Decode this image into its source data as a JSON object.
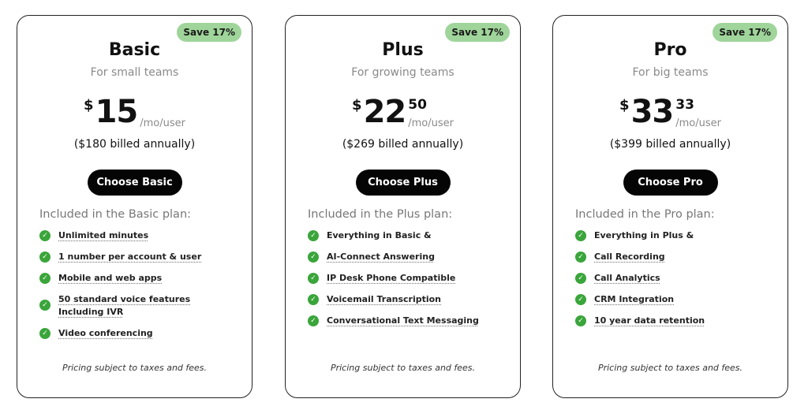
{
  "plans": [
    {
      "badge": "Save 17%",
      "name": "Basic",
      "subtitle": "For small teams",
      "currency": "$",
      "amount": "15",
      "cents": "",
      "per": "/mo/user",
      "billed": "($180 billed annually)",
      "cta": "Choose Basic",
      "included_title": "Included in the Basic plan:",
      "features": [
        "Unlimited minutes",
        "1 number per account & user",
        "Mobile and web apps",
        "50 standard voice features Including IVR",
        "Video conferencing"
      ],
      "footnote": "Pricing subject to taxes and fees."
    },
    {
      "badge": "Save 17%",
      "name": "Plus",
      "subtitle": "For growing teams",
      "currency": "$",
      "amount": "22",
      "cents": "50",
      "per": "/mo/user",
      "billed": "($269 billed annually)",
      "cta": "Choose Plus",
      "included_title": "Included in the Plus plan:",
      "features": [
        "Everything in Basic &",
        "AI-Connect Answering",
        "IP Desk Phone Compatible",
        "Voicemail Transcription",
        "Conversational Text Messaging"
      ],
      "footnote": "Pricing subject to taxes and fees."
    },
    {
      "badge": "Save 17%",
      "name": "Pro",
      "subtitle": "For big teams",
      "currency": "$",
      "amount": "33",
      "cents": "33",
      "per": "/mo/user",
      "billed": "($399 billed annually)",
      "cta": "Choose Pro",
      "included_title": "Included in the Pro plan:",
      "features": [
        "Everything in Plus &",
        "Call Recording",
        "Call Analytics",
        "CRM Integration",
        "10 year data retention"
      ],
      "footnote": "Pricing subject to taxes and fees."
    }
  ],
  "icons": {
    "feature_check": "check-circle-icon"
  },
  "colors": {
    "badge_bg": "#9fd59a",
    "check_green": "#3aa53a",
    "cta_bg": "#050505"
  }
}
